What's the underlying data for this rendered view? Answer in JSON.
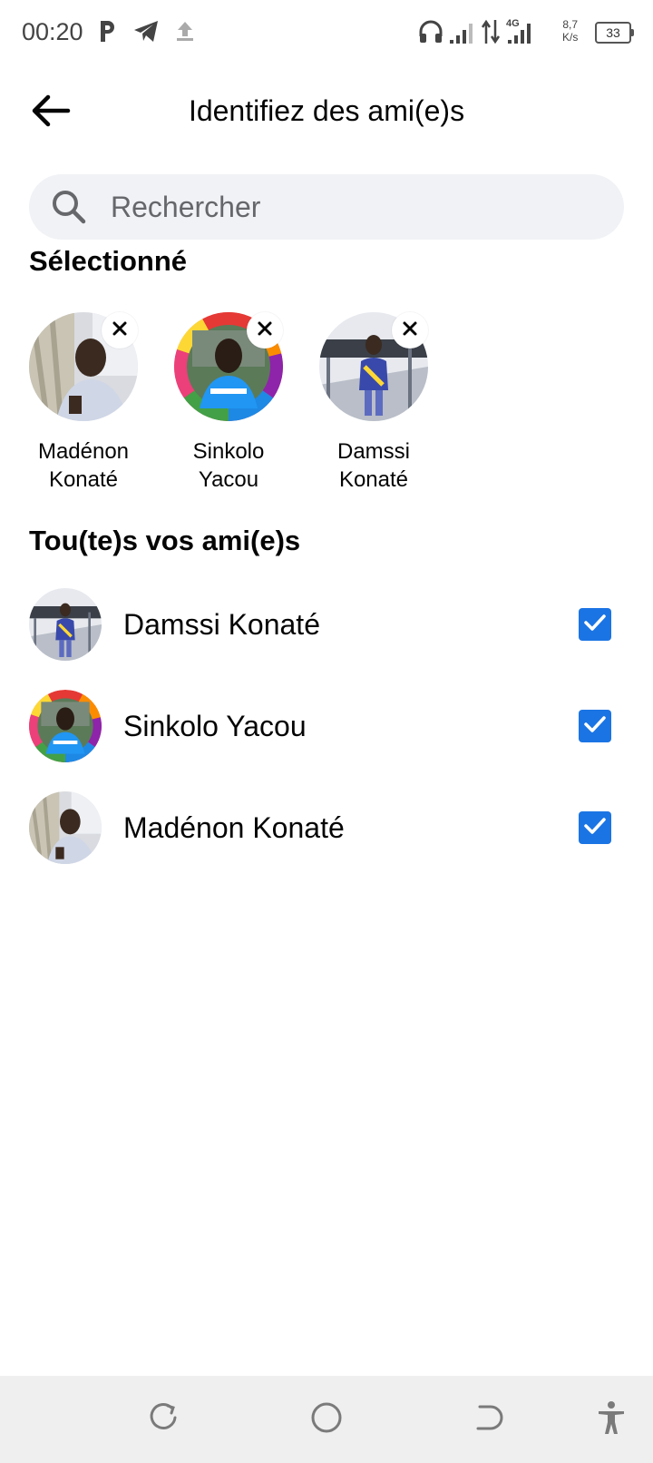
{
  "status_bar": {
    "time": "00:20",
    "net_speed_value": "8,7",
    "net_speed_unit": "K/s",
    "network_type": "4G",
    "battery": "33"
  },
  "header": {
    "title": "Identifiez des ami(e)s"
  },
  "search": {
    "placeholder": "Rechercher",
    "value": ""
  },
  "selected": {
    "heading": "Sélectionné",
    "items": [
      {
        "first": "Madénon",
        "last": "Konaté"
      },
      {
        "first": "Sinkolo",
        "last": "Yacou"
      },
      {
        "first": "Damssi",
        "last": "Konaté"
      }
    ]
  },
  "friends": {
    "heading": "Tou(te)s vos ami(e)s",
    "items": [
      {
        "name": "Damssi Konaté",
        "checked": true
      },
      {
        "name": "Sinkolo Yacou",
        "checked": true
      },
      {
        "name": "Madénon Konaté",
        "checked": true
      }
    ]
  },
  "colors": {
    "accent": "#1b74e4",
    "search_bg": "#f0f2f5",
    "nav_bg": "#efefef"
  },
  "icons": [
    "back-arrow-icon",
    "search-icon",
    "close-icon",
    "checkbox-checked-icon",
    "recent-apps-icon",
    "home-icon",
    "back-nav-icon",
    "accessibility-icon"
  ]
}
